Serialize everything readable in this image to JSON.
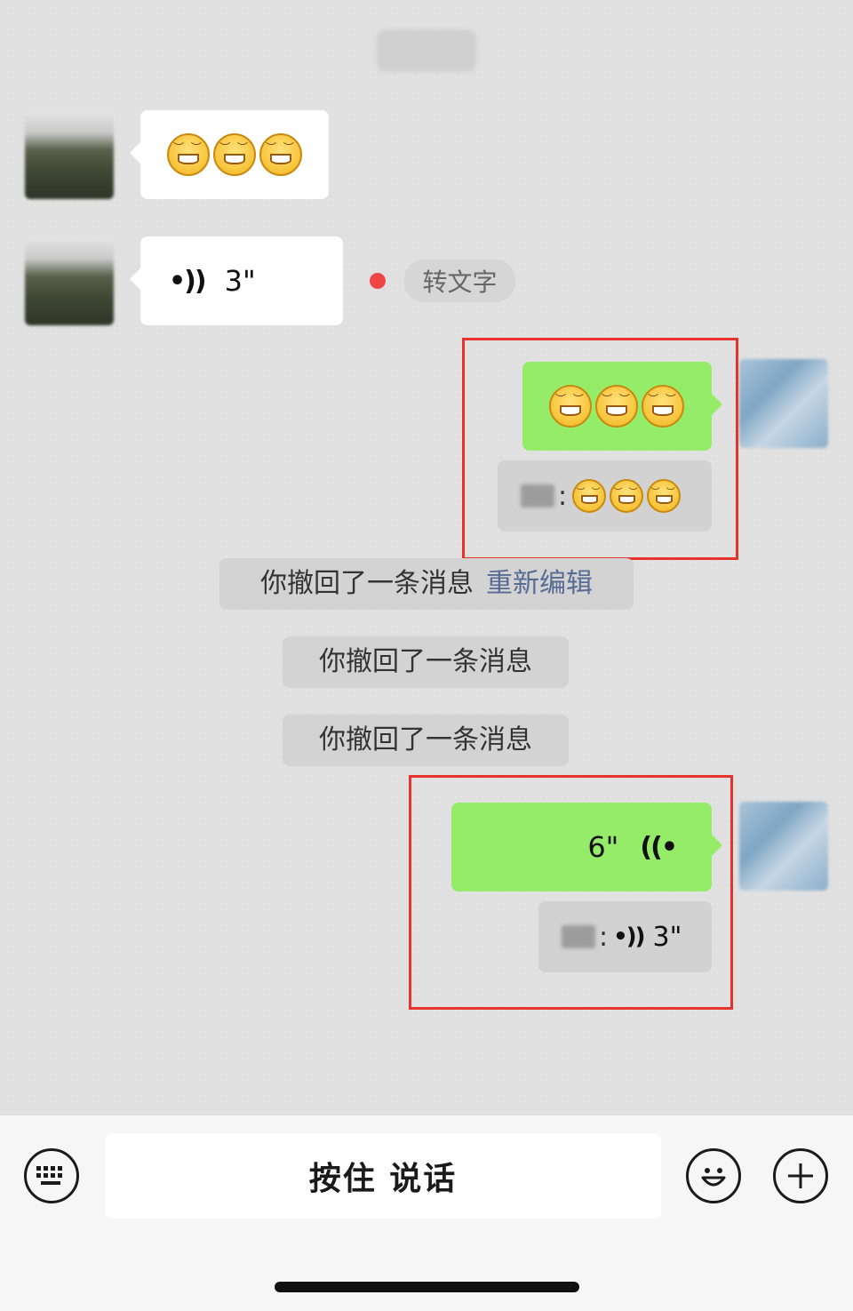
{
  "messages": {
    "incoming_voice": {
      "duration": "3\"",
      "transcribe_label": "转文字"
    },
    "outgoing_voice": {
      "duration": "6\""
    },
    "quote_voice": {
      "duration": "3\""
    },
    "colon": ":"
  },
  "system_messages": {
    "recalled_1": "你撤回了一条消息",
    "reedit_link": "重新编辑",
    "recalled_2": "你撤回了一条消息",
    "recalled_3": "你撤回了一条消息"
  },
  "input_bar": {
    "hold_to_talk": "按住 说话",
    "keyboard_icon": "keyboard-icon",
    "emoji_icon": "smiley-icon",
    "plus_icon": "plus-icon"
  },
  "colors": {
    "green_bubble": "#95ec69",
    "highlight_border": "#e8322c",
    "link": "#576b95",
    "unread_dot": "#f04545"
  }
}
